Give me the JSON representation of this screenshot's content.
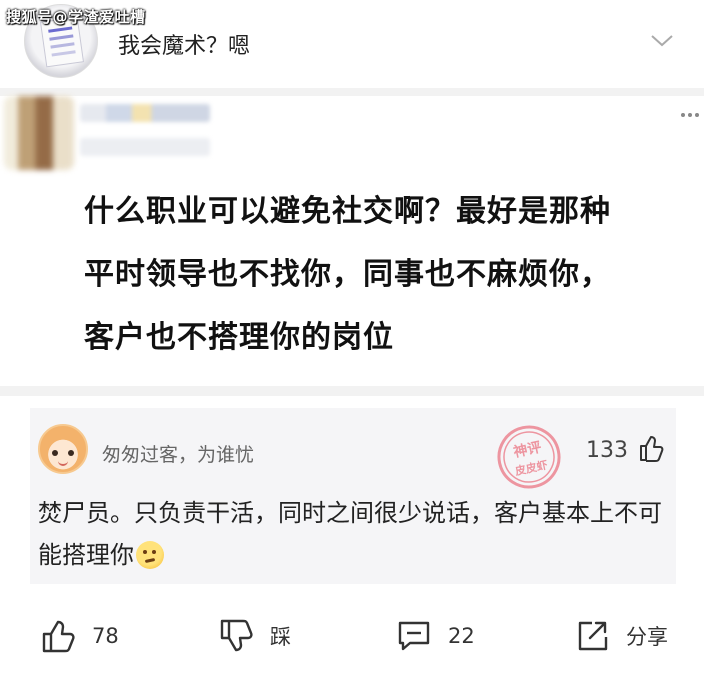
{
  "watermark": "搜狐号@学渣爱吐槽",
  "topic": {
    "title": "我会魔术？嗯"
  },
  "post": {
    "text_lines": [
      "什么职业可以避免社交啊？最好是那种",
      "平时领导也不找你，同事也不麻烦你，",
      "客户也不搭理你的岗位"
    ]
  },
  "comment": {
    "author": "匆匆过客，为谁忧",
    "likes": "133",
    "text": "焚尸员。只负责干活，同时之间很少说话，客户基本上不可能搭理你",
    "stamp_text_1": "神评",
    "stamp_text_2": "皮皮虾",
    "stamp_color": "#e8485a"
  },
  "actions": {
    "like_count": "78",
    "dislike_label": "踩",
    "comment_count": "22",
    "share_label": "分享"
  },
  "icons": [
    "chevron-down-icon",
    "more-dots-icon",
    "thumbs-up-icon",
    "thumbs-down-icon",
    "comment-icon",
    "share-icon",
    "thinking-emoji-icon"
  ]
}
